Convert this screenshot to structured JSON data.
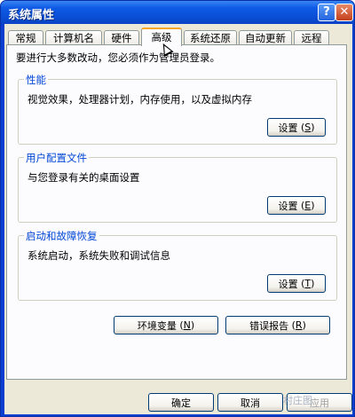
{
  "window": {
    "title": "系统属性",
    "help_symbol": "?",
    "close_symbol": "✕"
  },
  "tabs": [
    {
      "label": "常规"
    },
    {
      "label": "计算机名"
    },
    {
      "label": "硬件"
    },
    {
      "label": "高级",
      "active": true
    },
    {
      "label": "系统还原"
    },
    {
      "label": "自动更新"
    },
    {
      "label": "远程"
    }
  ],
  "panel": {
    "notice": "要进行大多数改动，您必须作为管理员登录。",
    "groups": [
      {
        "title": "性能",
        "description": "视觉效果，处理器计划，内存使用，以及虚拟内存",
        "button": "设置",
        "mnemonic": "S"
      },
      {
        "title": "用户配置文件",
        "description": "与您登录有关的桌面设置",
        "button": "设置",
        "mnemonic": "E"
      },
      {
        "title": "启动和故障恢复",
        "description": "系统启动，系统失败和调试信息",
        "button": "设置",
        "mnemonic": "T"
      }
    ],
    "env_button": {
      "label": "环境变量",
      "mnemonic": "N"
    },
    "error_button": {
      "label": "错误报告",
      "mnemonic": "R"
    }
  },
  "footer": {
    "ok": "确定",
    "cancel": "取消",
    "apply_partial": "应用"
  },
  "watermark": "村庄图"
}
